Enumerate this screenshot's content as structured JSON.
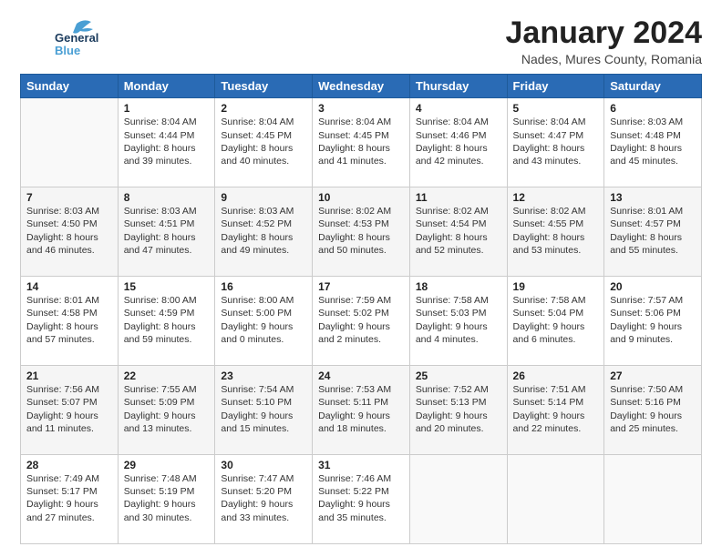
{
  "logo": {
    "line1": "General",
    "line2": "Blue"
  },
  "title": "January 2024",
  "subtitle": "Nades, Mures County, Romania",
  "days_header": [
    "Sunday",
    "Monday",
    "Tuesday",
    "Wednesday",
    "Thursday",
    "Friday",
    "Saturday"
  ],
  "weeks": [
    [
      {
        "num": "",
        "info": ""
      },
      {
        "num": "1",
        "info": "Sunrise: 8:04 AM\nSunset: 4:44 PM\nDaylight: 8 hours\nand 39 minutes."
      },
      {
        "num": "2",
        "info": "Sunrise: 8:04 AM\nSunset: 4:45 PM\nDaylight: 8 hours\nand 40 minutes."
      },
      {
        "num": "3",
        "info": "Sunrise: 8:04 AM\nSunset: 4:45 PM\nDaylight: 8 hours\nand 41 minutes."
      },
      {
        "num": "4",
        "info": "Sunrise: 8:04 AM\nSunset: 4:46 PM\nDaylight: 8 hours\nand 42 minutes."
      },
      {
        "num": "5",
        "info": "Sunrise: 8:04 AM\nSunset: 4:47 PM\nDaylight: 8 hours\nand 43 minutes."
      },
      {
        "num": "6",
        "info": "Sunrise: 8:03 AM\nSunset: 4:48 PM\nDaylight: 8 hours\nand 45 minutes."
      }
    ],
    [
      {
        "num": "7",
        "info": "Sunrise: 8:03 AM\nSunset: 4:50 PM\nDaylight: 8 hours\nand 46 minutes."
      },
      {
        "num": "8",
        "info": "Sunrise: 8:03 AM\nSunset: 4:51 PM\nDaylight: 8 hours\nand 47 minutes."
      },
      {
        "num": "9",
        "info": "Sunrise: 8:03 AM\nSunset: 4:52 PM\nDaylight: 8 hours\nand 49 minutes."
      },
      {
        "num": "10",
        "info": "Sunrise: 8:02 AM\nSunset: 4:53 PM\nDaylight: 8 hours\nand 50 minutes."
      },
      {
        "num": "11",
        "info": "Sunrise: 8:02 AM\nSunset: 4:54 PM\nDaylight: 8 hours\nand 52 minutes."
      },
      {
        "num": "12",
        "info": "Sunrise: 8:02 AM\nSunset: 4:55 PM\nDaylight: 8 hours\nand 53 minutes."
      },
      {
        "num": "13",
        "info": "Sunrise: 8:01 AM\nSunset: 4:57 PM\nDaylight: 8 hours\nand 55 minutes."
      }
    ],
    [
      {
        "num": "14",
        "info": "Sunrise: 8:01 AM\nSunset: 4:58 PM\nDaylight: 8 hours\nand 57 minutes."
      },
      {
        "num": "15",
        "info": "Sunrise: 8:00 AM\nSunset: 4:59 PM\nDaylight: 8 hours\nand 59 minutes."
      },
      {
        "num": "16",
        "info": "Sunrise: 8:00 AM\nSunset: 5:00 PM\nDaylight: 9 hours\nand 0 minutes."
      },
      {
        "num": "17",
        "info": "Sunrise: 7:59 AM\nSunset: 5:02 PM\nDaylight: 9 hours\nand 2 minutes."
      },
      {
        "num": "18",
        "info": "Sunrise: 7:58 AM\nSunset: 5:03 PM\nDaylight: 9 hours\nand 4 minutes."
      },
      {
        "num": "19",
        "info": "Sunrise: 7:58 AM\nSunset: 5:04 PM\nDaylight: 9 hours\nand 6 minutes."
      },
      {
        "num": "20",
        "info": "Sunrise: 7:57 AM\nSunset: 5:06 PM\nDaylight: 9 hours\nand 9 minutes."
      }
    ],
    [
      {
        "num": "21",
        "info": "Sunrise: 7:56 AM\nSunset: 5:07 PM\nDaylight: 9 hours\nand 11 minutes."
      },
      {
        "num": "22",
        "info": "Sunrise: 7:55 AM\nSunset: 5:09 PM\nDaylight: 9 hours\nand 13 minutes."
      },
      {
        "num": "23",
        "info": "Sunrise: 7:54 AM\nSunset: 5:10 PM\nDaylight: 9 hours\nand 15 minutes."
      },
      {
        "num": "24",
        "info": "Sunrise: 7:53 AM\nSunset: 5:11 PM\nDaylight: 9 hours\nand 18 minutes."
      },
      {
        "num": "25",
        "info": "Sunrise: 7:52 AM\nSunset: 5:13 PM\nDaylight: 9 hours\nand 20 minutes."
      },
      {
        "num": "26",
        "info": "Sunrise: 7:51 AM\nSunset: 5:14 PM\nDaylight: 9 hours\nand 22 minutes."
      },
      {
        "num": "27",
        "info": "Sunrise: 7:50 AM\nSunset: 5:16 PM\nDaylight: 9 hours\nand 25 minutes."
      }
    ],
    [
      {
        "num": "28",
        "info": "Sunrise: 7:49 AM\nSunset: 5:17 PM\nDaylight: 9 hours\nand 27 minutes."
      },
      {
        "num": "29",
        "info": "Sunrise: 7:48 AM\nSunset: 5:19 PM\nDaylight: 9 hours\nand 30 minutes."
      },
      {
        "num": "30",
        "info": "Sunrise: 7:47 AM\nSunset: 5:20 PM\nDaylight: 9 hours\nand 33 minutes."
      },
      {
        "num": "31",
        "info": "Sunrise: 7:46 AM\nSunset: 5:22 PM\nDaylight: 9 hours\nand 35 minutes."
      },
      {
        "num": "",
        "info": ""
      },
      {
        "num": "",
        "info": ""
      },
      {
        "num": "",
        "info": ""
      }
    ]
  ]
}
